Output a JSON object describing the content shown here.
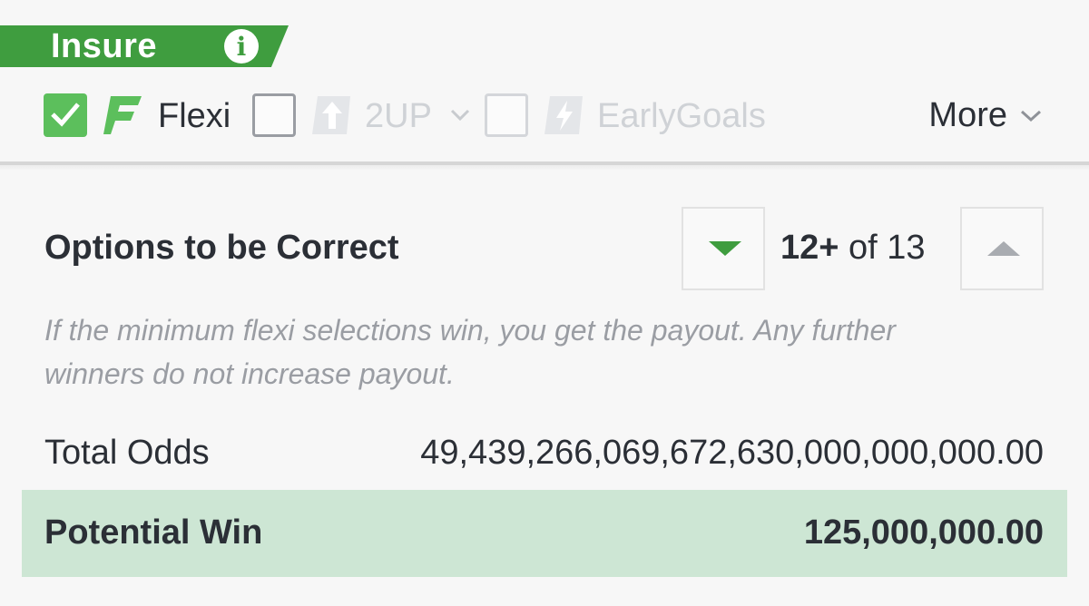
{
  "insure": {
    "label": "Insure",
    "info_icon": "info-icon"
  },
  "bet_options": {
    "flexi": {
      "label": "Flexi",
      "checked": true,
      "icon": "flexi-f-icon"
    },
    "twoup": {
      "label": "2UP",
      "checked": false,
      "icon": "up-arrow-icon"
    },
    "early_goals": {
      "label": "EarlyGoals",
      "checked": false,
      "icon": "lightning-icon"
    },
    "more_label": "More"
  },
  "flexi_options": {
    "title": "Options to be Correct",
    "count_bold": "12+",
    "count_rest": " of 13",
    "hint": "If the minimum flexi selections win, you get the payout. Any further winners do not increase payout."
  },
  "summary": {
    "total_odds_label": "Total Odds",
    "total_odds_value": "49,439,266,069,672,630,000,000,000.00",
    "potential_win_label": "Potential Win",
    "potential_win_value": "125,000,000.00"
  },
  "colors": {
    "brand_green": "#3f9d3f",
    "check_green": "#5cbf5c",
    "win_bg": "#cde6d4"
  }
}
